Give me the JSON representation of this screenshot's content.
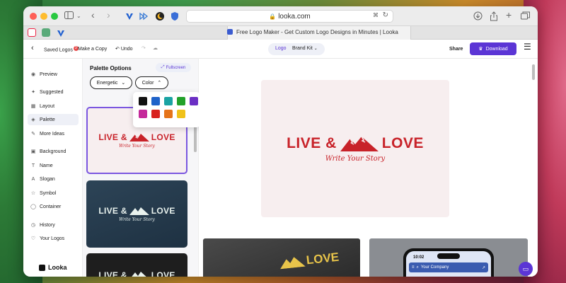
{
  "browser": {
    "url": "looka.com",
    "tab_title": "Free Logo Maker - Get Custom Logo Designs in Minutes | Looka"
  },
  "toolbar": {
    "saved_logos_label": "Saved Logos",
    "saved_logos_count": "3",
    "make_copy_label": "Make a Copy",
    "undo_label": "Undo",
    "logo_tab_label": "Logo",
    "brand_kit_label": "Brand Kit",
    "share_label": "Share",
    "download_label": "Download"
  },
  "sidebar": {
    "items": [
      {
        "label": "Preview",
        "icon": "eye-icon"
      },
      {
        "label": "Suggested",
        "icon": "sparkle-icon"
      },
      {
        "label": "Layout",
        "icon": "layout-icon"
      },
      {
        "label": "Palette",
        "icon": "palette-icon"
      },
      {
        "label": "More Ideas",
        "icon": "lightbulb-icon"
      },
      {
        "label": "Background",
        "icon": "background-icon"
      },
      {
        "label": "Name",
        "icon": "text-icon"
      },
      {
        "label": "Slogan",
        "icon": "slogan-icon"
      },
      {
        "label": "Symbol",
        "icon": "star-icon"
      },
      {
        "label": "Container",
        "icon": "container-icon"
      },
      {
        "label": "History",
        "icon": "history-icon"
      },
      {
        "label": "Your Logos",
        "icon": "heart-icon"
      }
    ],
    "active": "Palette",
    "brand": "Looka"
  },
  "palette": {
    "title": "Palette Options",
    "fullscreen_label": "Fullscreen",
    "style_dropdown": "Energetic",
    "color_dropdown": "Color",
    "swatches": [
      "#111111",
      "#1f62c9",
      "#1aa3a3",
      "#22a12a",
      "#6b2fc4",
      "#c42a9a",
      "#d8221e",
      "#e5741a",
      "#f0c21a"
    ]
  },
  "logo": {
    "name": "LIVE & ",
    "name2": " LOVE",
    "slogan": "Write Your Story"
  },
  "mockups": {
    "phone_time": "10:02",
    "phone_search_text": "Your Company"
  },
  "colors": {
    "accent": "#5b35d5",
    "logo_red": "#c82229"
  }
}
